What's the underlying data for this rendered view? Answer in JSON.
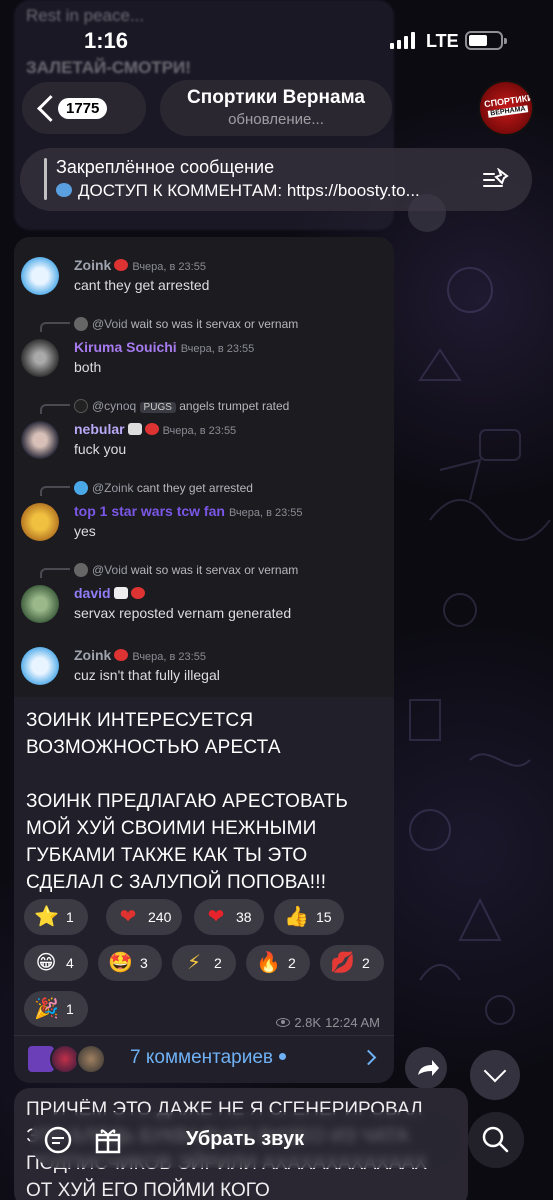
{
  "status_bar": {
    "time": "1:16",
    "network": "LTE"
  },
  "background_text": {
    "line1": "Rest in peace...",
    "line2": "ЗАЛЕТАЙ-СМОТРИ!"
  },
  "header": {
    "unread_count": "1775",
    "title": "Спортики Вернама",
    "subtitle": "обновление...",
    "avatar_logo_line1": "СПОРТИКИ",
    "avatar_logo_line2": "ВЕРНАМА"
  },
  "pinned": {
    "label": "Закреплённое сообщение",
    "text": "ДОСТУП К КОММЕНТАМ: https://boosty.to..."
  },
  "discord_messages": [
    {
      "name": "Zoink",
      "time": "Вчера, в 23:55",
      "text": "cant they get arrested",
      "name_color": "#9ea3ad"
    },
    {
      "reply_user": "@Void",
      "reply_text": "wait so was it servax or vernam",
      "name": "Kiruma Souichi",
      "time": "Вчера, в 23:55",
      "text": "both",
      "name_color": "#a77bf0"
    },
    {
      "reply_user": "@cynoq",
      "reply_tag": "PUGS",
      "reply_text": "angels trumpet rated",
      "name": "nebular",
      "time": "Вчера, в 23:55",
      "text": "fuck you",
      "name_color": "#b8a8f5"
    },
    {
      "reply_user": "@Zoink",
      "reply_text": "cant they get arrested",
      "name": "top 1 star wars tcw fan",
      "time": "Вчера, в 23:55",
      "text": "yes",
      "name_color": "#7a57e6"
    },
    {
      "reply_user": "@Void",
      "reply_text": "wait so was it servax or vernam",
      "name": "david",
      "time": "Вчера, в 23:55",
      "text": "servax reposted vernam generated",
      "name_color": "#8f7ef5"
    },
    {
      "name": "Zoink",
      "time": "Вчера, в 23:55",
      "text": "cuz isn't that fully illegal",
      "name_color": "#9ea3ad"
    }
  ],
  "caption": {
    "p1": "ЗОИНК ИНТЕРЕСУЕТСЯ ВОЗМОЖНОСТЬЮ АРЕСТА",
    "p2": "ЗОИНК ПРЕДЛАГАЮ АРЕСТОВАТЬ МОЙ ХУЙ СВОИМИ НЕЖНЫМИ ГУБКАМИ ТАКЖЕ КАК ТЫ ЭТО СДЕЛАЛ С ЗАЛУПОЙ ПОПОВА!!!"
  },
  "reactions": [
    {
      "icon": "star-icon",
      "glyph": "⭐",
      "count": "1"
    },
    {
      "icon": "heart-on-fire-icon",
      "glyph": "❤",
      "count": "240"
    },
    {
      "icon": "red-heart-icon",
      "glyph": "❤",
      "count": "38"
    },
    {
      "icon": "thumbs-up-icon",
      "glyph": "👍",
      "count": "15"
    },
    {
      "icon": "grinning-face-icon",
      "glyph": "😁",
      "count": "4"
    },
    {
      "icon": "star-struck-icon",
      "glyph": "🤩",
      "count": "3"
    },
    {
      "icon": "lightning-icon",
      "glyph": "⚡",
      "count": "2"
    },
    {
      "icon": "fire-icon",
      "glyph": "🔥",
      "count": "2"
    },
    {
      "icon": "kiss-mark-icon",
      "glyph": "💋",
      "count": "2"
    },
    {
      "icon": "party-popper-icon",
      "glyph": "🎉",
      "count": "1"
    }
  ],
  "meta": {
    "views": "2.8K",
    "time": "12:24 AM"
  },
  "comments": {
    "label": "7 комментариев"
  },
  "next_message": {
    "text": "ПРИЧЁМ ЭТО ДАЖЕ НЕ Я СГЕНЕРИРОВАЛ ЭТО БЛЯДЬ БУКВАЛЬНО ВИДЕО ИЗ ЧАТА ПОДПИСЧИКОВ ЭЙРИЛИ АХАХАХАХАХААХ ОТ ХУЙ ЕГО ПОЙМИ КОГО"
  },
  "bottom_bar": {
    "mute_label": "Убрать звук"
  },
  "colors": {
    "accent": "#6fb1f5",
    "bubble": "#211f2a",
    "discord_bg": "#1c1b20"
  }
}
